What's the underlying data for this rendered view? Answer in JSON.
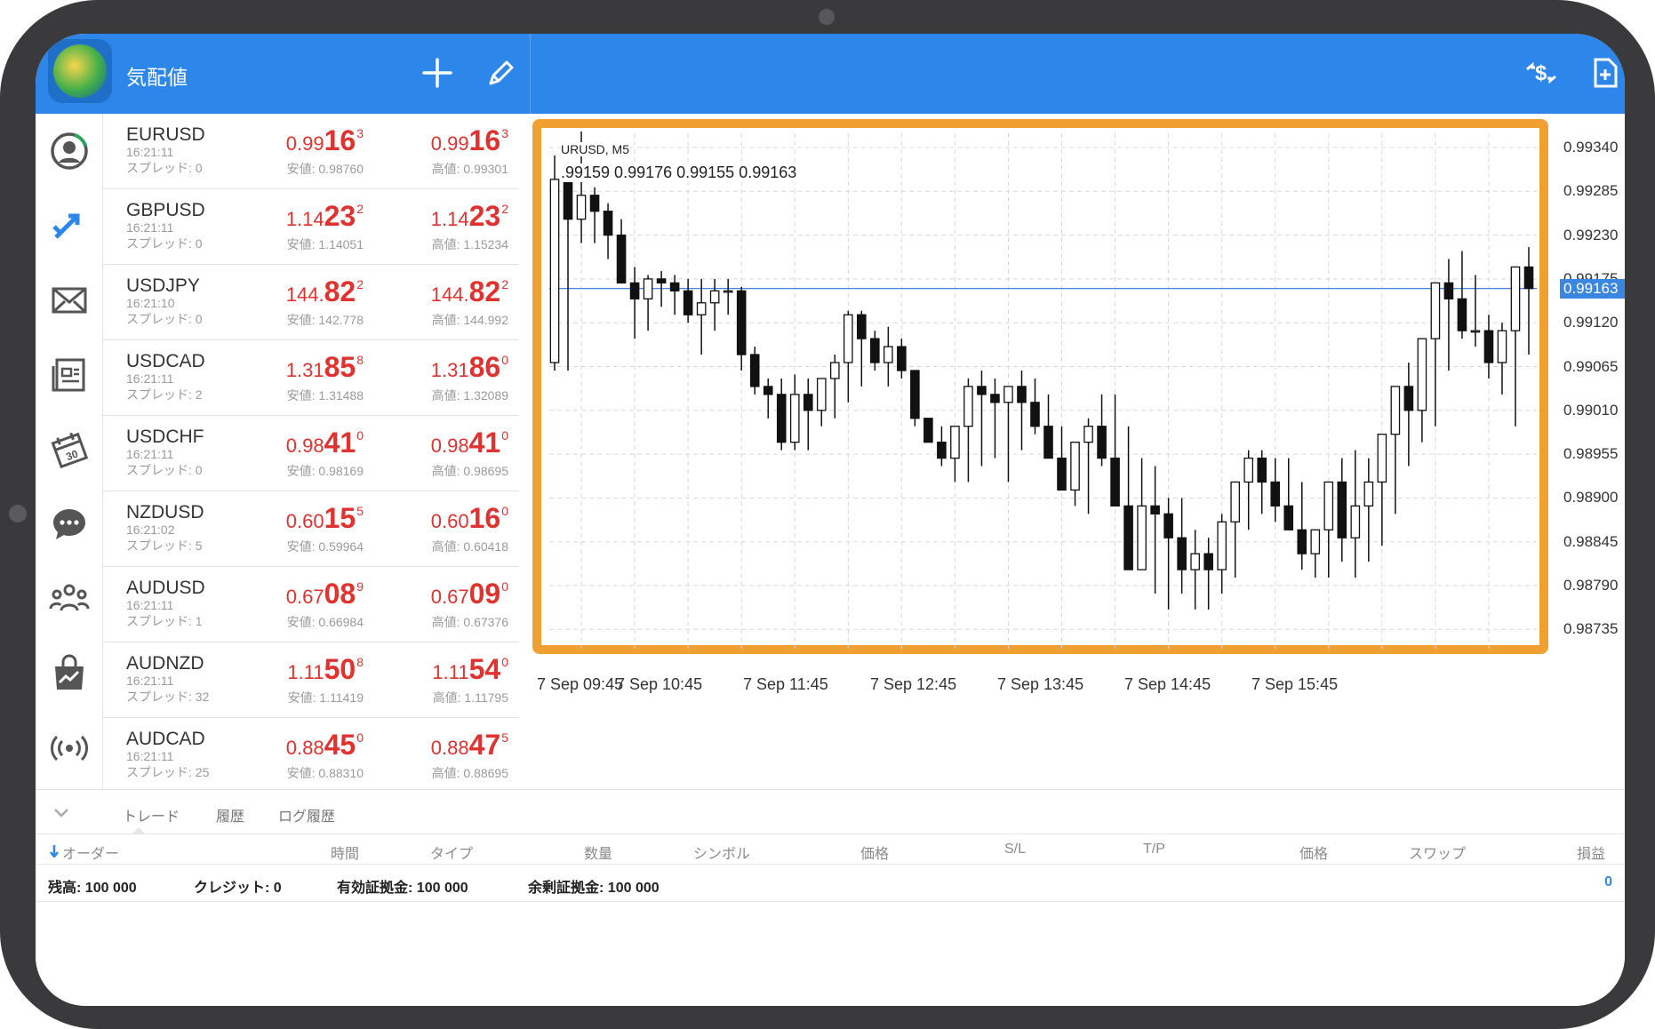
{
  "colors": {
    "accent": "#2d86ea",
    "price_red": "#e0322f",
    "highlight_frame": "#f0a030",
    "current_price_line": "#3a86e0"
  },
  "header": {
    "title": "気配値"
  },
  "quotes": [
    {
      "symbol": "EURUSD",
      "time": "16:21:11",
      "spread": "スプレッド: 0",
      "bid": {
        "a": "0.99",
        "b": "16",
        "c": "3"
      },
      "ask": {
        "a": "0.99",
        "b": "16",
        "c": "3"
      },
      "low": "安値: 0.98760",
      "high": "高値: 0.99301"
    },
    {
      "symbol": "GBPUSD",
      "time": "16:21:11",
      "spread": "スプレッド: 0",
      "bid": {
        "a": "1.14",
        "b": "23",
        "c": "2"
      },
      "ask": {
        "a": "1.14",
        "b": "23",
        "c": "2"
      },
      "low": "安値: 1.14051",
      "high": "高値: 1.15234"
    },
    {
      "symbol": "USDJPY",
      "time": "16:21:10",
      "spread": "スプレッド: 0",
      "bid": {
        "a": "144.",
        "b": "82",
        "c": "2"
      },
      "ask": {
        "a": "144.",
        "b": "82",
        "c": "2"
      },
      "low": "安値: 142.778",
      "high": "高値: 144.992"
    },
    {
      "symbol": "USDCAD",
      "time": "16:21:11",
      "spread": "スプレッド: 2",
      "bid": {
        "a": "1.31",
        "b": "85",
        "c": "8"
      },
      "ask": {
        "a": "1.31",
        "b": "86",
        "c": "0"
      },
      "low": "安値: 1.31488",
      "high": "高値: 1.32089"
    },
    {
      "symbol": "USDCHF",
      "time": "16:21:11",
      "spread": "スプレッド: 0",
      "bid": {
        "a": "0.98",
        "b": "41",
        "c": "0"
      },
      "ask": {
        "a": "0.98",
        "b": "41",
        "c": "0"
      },
      "low": "安値: 0.98169",
      "high": "高値: 0.98695"
    },
    {
      "symbol": "NZDUSD",
      "time": "16:21:02",
      "spread": "スプレッド: 5",
      "bid": {
        "a": "0.60",
        "b": "15",
        "c": "5"
      },
      "ask": {
        "a": "0.60",
        "b": "16",
        "c": "0"
      },
      "low": "安値: 0.59964",
      "high": "高値: 0.60418"
    },
    {
      "symbol": "AUDUSD",
      "time": "16:21:11",
      "spread": "スプレッド: 1",
      "bid": {
        "a": "0.67",
        "b": "08",
        "c": "9"
      },
      "ask": {
        "a": "0.67",
        "b": "09",
        "c": "0"
      },
      "low": "安値: 0.66984",
      "high": "高値: 0.67376"
    },
    {
      "symbol": "AUDNZD",
      "time": "16:21:11",
      "spread": "スプレッド: 32",
      "bid": {
        "a": "1.11",
        "b": "50",
        "c": "8"
      },
      "ask": {
        "a": "1.11",
        "b": "54",
        "c": "0"
      },
      "low": "安値: 1.11419",
      "high": "高値: 1.11795"
    },
    {
      "symbol": "AUDCAD",
      "time": "16:21:11",
      "spread": "スプレッド: 25",
      "bid": {
        "a": "0.88",
        "b": "45",
        "c": "0"
      },
      "ask": {
        "a": "0.88",
        "b": "47",
        "c": "5"
      },
      "low": "安値: 0.88310",
      "high": "高値: 0.88695"
    }
  ],
  "chart": {
    "symbol_label": "URUSD, M5",
    "ohlc_label": ".99159 0.99176 0.99155 0.99163",
    "current_price": "0.99163",
    "y_ticks": [
      "0.99340",
      "0.99285",
      "0.99230",
      "0.99175",
      "0.99120",
      "0.99065",
      "0.99010",
      "0.98955",
      "0.98900",
      "0.98845",
      "0.98790",
      "0.98735"
    ],
    "x_ticks": [
      "7 Sep 09:45",
      "7 Sep 10:45",
      "7 Sep 11:45",
      "7 Sep 12:45",
      "7 Sep 13:45",
      "7 Sep 14:45",
      "7 Sep 15:45"
    ]
  },
  "chart_data": {
    "type": "candlestick",
    "timeframe": "M5",
    "x": [
      "09:45",
      "09:50",
      "09:55",
      "10:00",
      "10:05",
      "10:10",
      "10:15",
      "10:20",
      "10:25",
      "10:30",
      "10:35",
      "10:40",
      "10:45",
      "10:50",
      "10:55",
      "11:00",
      "11:05",
      "11:10",
      "11:15",
      "11:20",
      "11:25",
      "11:30",
      "11:35",
      "11:40",
      "11:45",
      "11:50",
      "11:55",
      "12:00",
      "12:05",
      "12:10",
      "12:15",
      "12:20",
      "12:25",
      "12:30",
      "12:35",
      "12:40",
      "12:45",
      "12:50",
      "12:55",
      "13:00",
      "13:05",
      "13:10",
      "13:15",
      "13:20",
      "13:25",
      "13:30",
      "13:35",
      "13:40",
      "13:45",
      "13:50",
      "13:55",
      "14:00",
      "14:05",
      "14:10",
      "14:15",
      "14:20",
      "14:25",
      "14:30",
      "14:35",
      "14:40",
      "14:45",
      "14:50",
      "14:55",
      "15:00",
      "15:05",
      "15:10",
      "15:15",
      "15:20",
      "15:25",
      "15:30",
      "15:35",
      "15:40",
      "15:45",
      "15:50"
    ],
    "open": [
      0.9907,
      0.993,
      0.9925,
      0.9928,
      0.9926,
      0.9923,
      0.9917,
      0.9915,
      0.99175,
      0.9917,
      0.9916,
      0.9913,
      0.99145,
      0.9916,
      0.9916,
      0.9908,
      0.9904,
      0.9903,
      0.9897,
      0.9903,
      0.9901,
      0.9905,
      0.9907,
      0.9913,
      0.991,
      0.9907,
      0.9909,
      0.9906,
      0.99,
      0.9897,
      0.9895,
      0.9899,
      0.9904,
      0.9903,
      0.9902,
      0.9904,
      0.9902,
      0.9899,
      0.9895,
      0.9891,
      0.9897,
      0.9899,
      0.9895,
      0.9889,
      0.9881,
      0.9889,
      0.9888,
      0.9885,
      0.9881,
      0.9883,
      0.9881,
      0.9887,
      0.9892,
      0.9895,
      0.9892,
      0.9889,
      0.9886,
      0.9883,
      0.9886,
      0.9892,
      0.9885,
      0.9889,
      0.9892,
      0.9898,
      0.9904,
      0.9901,
      0.991,
      0.9917,
      0.9915,
      0.9911,
      0.9911,
      0.9907,
      0.9911,
      0.9919
    ],
    "high": [
      0.9933,
      0.9932,
      0.9936,
      0.9929,
      0.9927,
      0.9925,
      0.9919,
      0.9918,
      0.99185,
      0.9918,
      0.99175,
      0.99175,
      0.99175,
      0.99175,
      0.99165,
      0.9909,
      0.9905,
      0.9905,
      0.99055,
      0.9905,
      0.9905,
      0.9908,
      0.99135,
      0.99135,
      0.9911,
      0.99115,
      0.991,
      0.9906,
      0.99,
      0.9899,
      0.9898,
      0.9905,
      0.9906,
      0.9905,
      0.9904,
      0.9906,
      0.9905,
      0.9903,
      0.9899,
      0.9896,
      0.99,
      0.9903,
      0.9903,
      0.9899,
      0.9895,
      0.9894,
      0.989,
      0.989,
      0.9886,
      0.9885,
      0.9888,
      0.9889,
      0.9896,
      0.9896,
      0.9895,
      0.9895,
      0.9892,
      0.9886,
      0.9888,
      0.9895,
      0.9896,
      0.9895,
      0.9893,
      0.99,
      0.9907,
      0.9904,
      0.9913,
      0.992,
      0.9921,
      0.9918,
      0.9913,
      0.9912,
      0.9916,
      0.99215
    ],
    "low": [
      0.9906,
      0.9906,
      0.9922,
      0.9922,
      0.992,
      0.992,
      0.991,
      0.9911,
      0.9914,
      0.9913,
      0.9912,
      0.9908,
      0.9911,
      0.9913,
      0.9906,
      0.9903,
      0.99,
      0.9896,
      0.9896,
      0.9896,
      0.9899,
      0.99,
      0.9902,
      0.9904,
      0.9906,
      0.9904,
      0.9905,
      0.9899,
      0.9897,
      0.9894,
      0.9892,
      0.9892,
      0.9894,
      0.9895,
      0.9892,
      0.9896,
      0.9898,
      0.9896,
      0.9892,
      0.9889,
      0.9888,
      0.9894,
      0.9893,
      0.9886,
      0.9881,
      0.9878,
      0.9876,
      0.9878,
      0.9876,
      0.9876,
      0.9878,
      0.988,
      0.9886,
      0.9888,
      0.9887,
      0.9886,
      0.9881,
      0.988,
      0.988,
      0.9882,
      0.988,
      0.9882,
      0.9884,
      0.9888,
      0.9894,
      0.9897,
      0.9899,
      0.9906,
      0.991,
      0.9909,
      0.9905,
      0.9903,
      0.9899,
      0.9908
    ],
    "close": [
      0.993,
      0.9925,
      0.9928,
      0.9926,
      0.9923,
      0.9917,
      0.9915,
      0.99175,
      0.9917,
      0.9916,
      0.9913,
      0.99145,
      0.9916,
      0.9916,
      0.9908,
      0.9904,
      0.9903,
      0.9897,
      0.9903,
      0.9901,
      0.9905,
      0.9907,
      0.9913,
      0.991,
      0.9907,
      0.9909,
      0.9906,
      0.99,
      0.9897,
      0.9895,
      0.9899,
      0.9904,
      0.9903,
      0.9902,
      0.9904,
      0.9902,
      0.9899,
      0.9895,
      0.9891,
      0.9897,
      0.9899,
      0.9895,
      0.9889,
      0.9881,
      0.9889,
      0.9888,
      0.9885,
      0.9881,
      0.9883,
      0.9881,
      0.9887,
      0.9892,
      0.9895,
      0.9892,
      0.9889,
      0.9886,
      0.9883,
      0.9886,
      0.9892,
      0.9885,
      0.9889,
      0.9892,
      0.9898,
      0.9904,
      0.9901,
      0.991,
      0.9917,
      0.9915,
      0.9911,
      0.9911,
      0.9907,
      0.9911,
      0.9919,
      0.99163
    ],
    "ylim": [
      0.9871,
      0.9937
    ],
    "current_price": 0.99163
  },
  "bottom": {
    "tabs": [
      "トレード",
      "履歴",
      "ログ履歴"
    ],
    "columns": [
      "オーダー",
      "時間",
      "タイプ",
      "数量",
      "シンボル",
      "価格",
      "S/L",
      "T/P",
      "価格",
      "スワップ",
      "損益"
    ],
    "account": [
      {
        "label": "残高:",
        "value": "100 000"
      },
      {
        "label": "クレジット:",
        "value": "0"
      },
      {
        "label": "有効証拠金:",
        "value": "100 000"
      },
      {
        "label": "余剰証拠金:",
        "value": "100 000"
      }
    ],
    "profit_total": "0"
  }
}
